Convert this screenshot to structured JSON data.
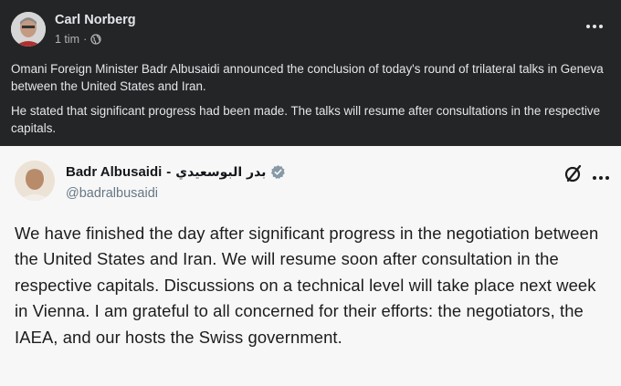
{
  "facebook_post": {
    "author_name": "Carl Norberg",
    "time": "1 tim",
    "separator": "·",
    "privacy_icon": "globe-icon",
    "more_icon": "ellipsis-icon",
    "paragraphs": [
      "Omani Foreign Minister Badr Albusaidi announced the conclusion of today's round of trilateral talks in Geneva between the United States and Iran.",
      "He stated that significant progress had been made. The talks will resume after consultations in the respective capitals."
    ]
  },
  "tweet": {
    "display_name": "Badr Albusaidi",
    "name_separator": "-",
    "arabic_name": "بدر البوسعيدي",
    "handle": "@badralbusaidi",
    "verified_icon": "verified-badge-icon",
    "action_icon": "x-logo-icon",
    "more_icon": "ellipsis-icon",
    "text": "We have finished the day after significant progress in the negotiation between the United States and Iran. We will resume soon after consultation in the respective capitals. Discussions on a technical level will take place next week in Vienna. I am grateful to all concerned for their efforts: the negotiators, the IAEA, and our hosts the Swiss government.",
    "colors": {
      "verified": "#1d9bf0",
      "background": "#f7f7f7"
    }
  }
}
